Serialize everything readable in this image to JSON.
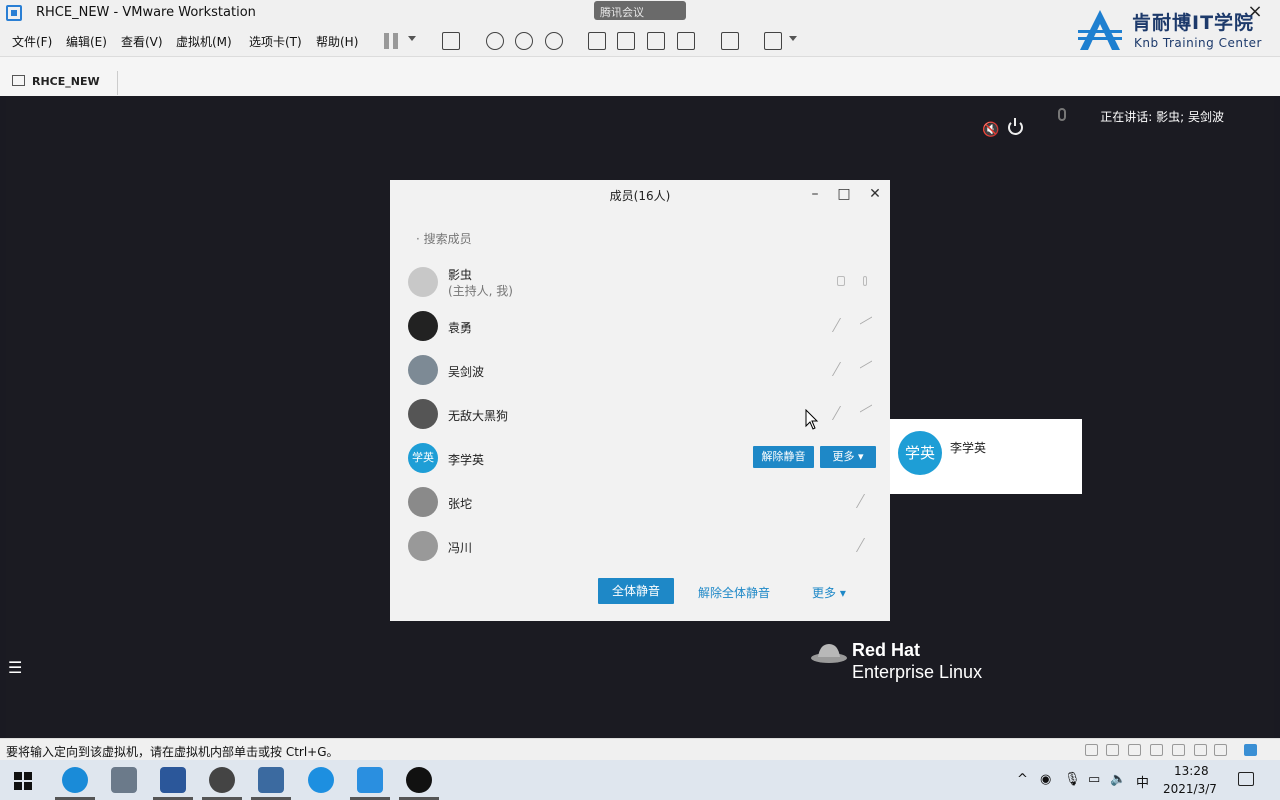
{
  "window": {
    "title": "RHCE_NEW - VMware Workstation",
    "meeting_pill": "腾讯会议",
    "close_glyph": "×"
  },
  "menubar": {
    "items": [
      "文件(F)",
      "编辑(E)",
      "查看(V)",
      "虚拟机(M)",
      "选项卡(T)",
      "帮助(H)"
    ]
  },
  "logo": {
    "name": "肯耐博IT学院",
    "tagline": "Knb Training Center"
  },
  "tabbar": {
    "vm_tab": "RHCE_NEW"
  },
  "guest": {
    "speaker_text": "正在讲话: 影虫; 吴剑波",
    "redhat_name": "Red Hat",
    "redhat_product": "Enterprise Linux",
    "menu_glyph": "☰"
  },
  "members_dialog": {
    "title": "成员(16人)",
    "search_placeholder": "搜索成员",
    "members": [
      {
        "name": "影虫",
        "role": "(主持人, 我)"
      },
      {
        "name": "袁勇"
      },
      {
        "name": "吴剑波"
      },
      {
        "name": "无敌大黑狗"
      },
      {
        "name": "李学英",
        "avatar_text": "学英",
        "unmute": "解除静音",
        "more": "更多 ▾"
      },
      {
        "name": "张坨"
      },
      {
        "name": "冯川"
      }
    ],
    "mute_all": "全体静音",
    "unmute_all": "解除全体静音",
    "more": "更多 ▾"
  },
  "member_card": {
    "avatar_text": "学英",
    "name": "李学英"
  },
  "statusbar": {
    "text": "要将输入定向到该虚拟机，请在虚拟机内部单击或按 Ctrl+G。"
  },
  "taskbar": {
    "ime": "中",
    "time": "13:28",
    "date": "2021/3/7",
    "tray_up": "^"
  }
}
